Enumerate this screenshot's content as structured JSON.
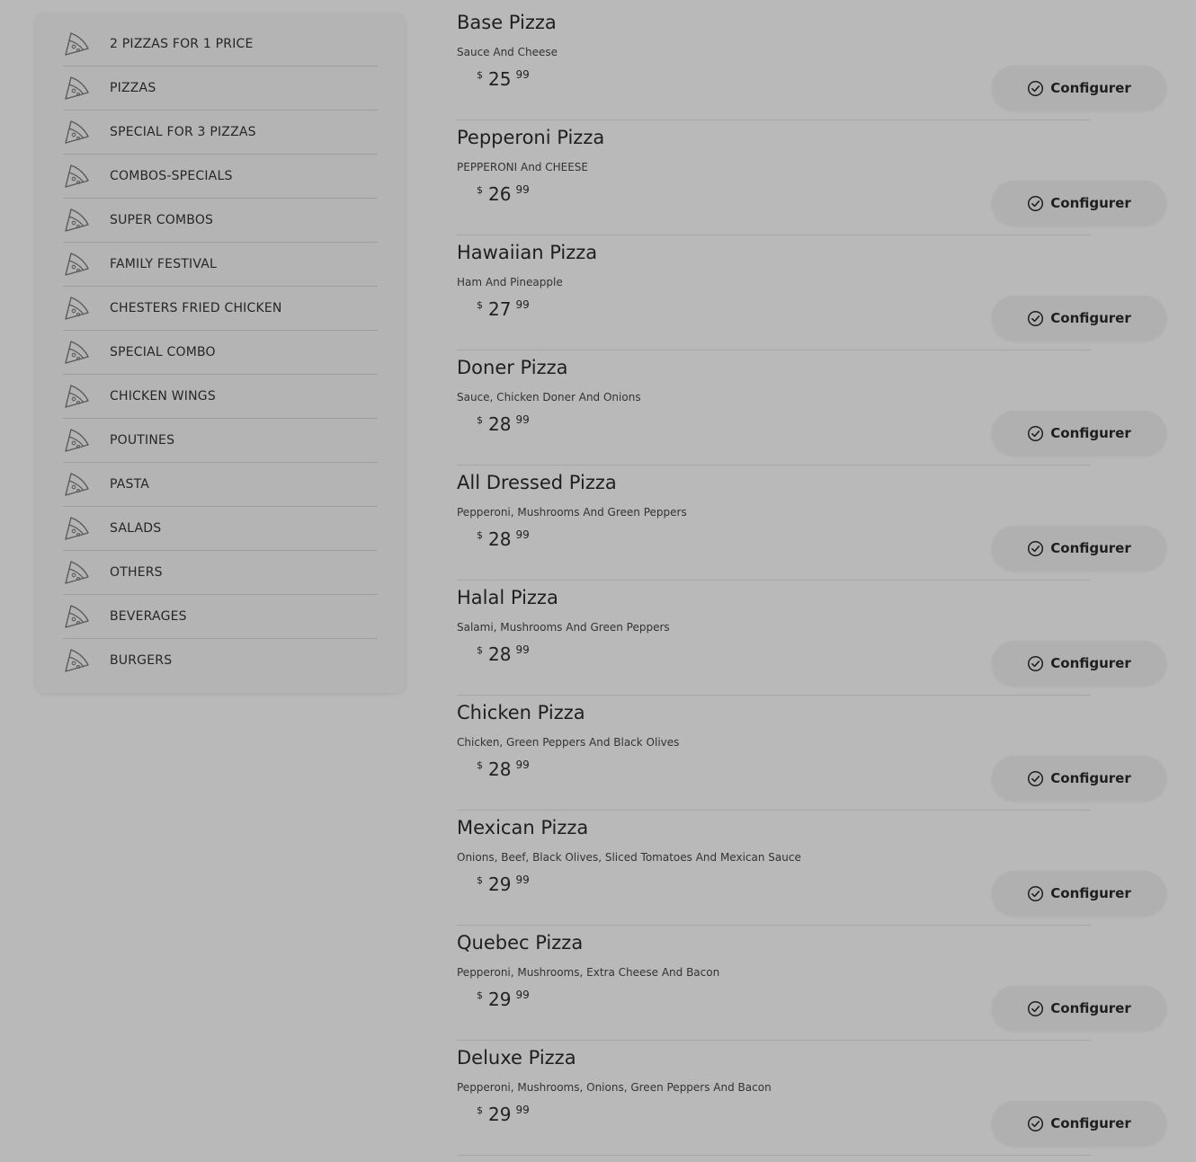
{
  "sidebar": {
    "items": [
      {
        "label": "2 PIZZAS FOR 1 PRICE",
        "icon": "pizza-slice-icon"
      },
      {
        "label": "PIZZAS",
        "icon": "pizza-slice-icon"
      },
      {
        "label": "SPECIAL FOR 3 PIZZAS",
        "icon": "pizza-slice-icon"
      },
      {
        "label": "COMBOS-SPECIALS",
        "icon": "pizza-slice-icon"
      },
      {
        "label": "SUPER COMBOS",
        "icon": "pizza-slice-icon"
      },
      {
        "label": "FAMILY FESTIVAL",
        "icon": "pizza-slice-icon"
      },
      {
        "label": "CHESTERS FRIED CHICKEN",
        "icon": "pizza-slice-icon"
      },
      {
        "label": "SPECIAL COMBO",
        "icon": "pizza-slice-icon"
      },
      {
        "label": "CHICKEN WINGS",
        "icon": "pizza-slice-icon"
      },
      {
        "label": "POUTINES",
        "icon": "pizza-slice-icon"
      },
      {
        "label": "PASTA",
        "icon": "pizza-slice-icon"
      },
      {
        "label": "SALADS",
        "icon": "pizza-slice-icon"
      },
      {
        "label": "OTHERS",
        "icon": "pizza-slice-icon"
      },
      {
        "label": "BEVERAGES",
        "icon": "pizza-slice-icon"
      },
      {
        "label": "BURGERS",
        "icon": "pizza-slice-icon"
      }
    ]
  },
  "products": [
    {
      "name": "Base Pizza",
      "description": "Sauce And Cheese",
      "currency": "$",
      "price_main": "25",
      "price_cents": "99",
      "button_label": "Configurer"
    },
    {
      "name": "Pepperoni Pizza",
      "description": "PEPPERONI And CHEESE",
      "currency": "$",
      "price_main": "26",
      "price_cents": "99",
      "button_label": "Configurer"
    },
    {
      "name": "Hawaiian Pizza",
      "description": "Ham And Pineapple",
      "currency": "$",
      "price_main": "27",
      "price_cents": "99",
      "button_label": "Configurer"
    },
    {
      "name": "Doner Pizza",
      "description": "Sauce, Chicken Doner And Onions",
      "currency": "$",
      "price_main": "28",
      "price_cents": "99",
      "button_label": "Configurer"
    },
    {
      "name": "All Dressed Pizza",
      "description": "Pepperoni, Mushrooms And Green Peppers",
      "currency": "$",
      "price_main": "28",
      "price_cents": "99",
      "button_label": "Configurer"
    },
    {
      "name": "Halal Pizza",
      "description": "Salami, Mushrooms And Green Peppers",
      "currency": "$",
      "price_main": "28",
      "price_cents": "99",
      "button_label": "Configurer"
    },
    {
      "name": "Chicken Pizza",
      "description": "Chicken, Green Peppers And Black Olives",
      "currency": "$",
      "price_main": "28",
      "price_cents": "99",
      "button_label": "Configurer"
    },
    {
      "name": "Mexican Pizza",
      "description": "Onions, Beef, Black Olives, Sliced Tomatoes And Mexican Sauce",
      "currency": "$",
      "price_main": "29",
      "price_cents": "99",
      "button_label": "Configurer"
    },
    {
      "name": "Quebec Pizza",
      "description": "Pepperoni, Mushrooms, Extra Cheese And Bacon",
      "currency": "$",
      "price_main": "29",
      "price_cents": "99",
      "button_label": "Configurer"
    },
    {
      "name": "Deluxe Pizza",
      "description": "Pepperoni, Mushrooms, Onions, Green Peppers And Bacon",
      "currency": "$",
      "price_main": "29",
      "price_cents": "99",
      "button_label": "Configurer"
    }
  ]
}
